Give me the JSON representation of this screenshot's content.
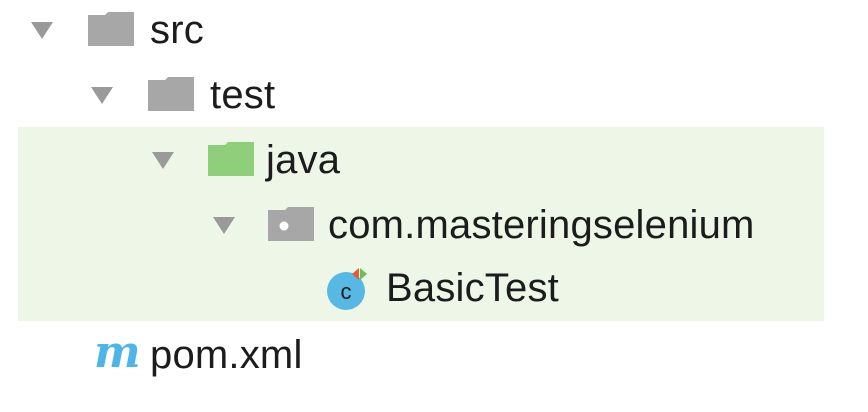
{
  "tree": {
    "nodes": [
      {
        "label": "src",
        "icon": "folder-icon",
        "expanded": true,
        "depth": 0
      },
      {
        "label": "test",
        "icon": "folder-icon",
        "expanded": true,
        "depth": 1
      },
      {
        "label": "java",
        "icon": "test-source-folder-icon",
        "expanded": true,
        "depth": 2,
        "highlighted": true
      },
      {
        "label": "com.masteringselenium",
        "icon": "package-icon",
        "expanded": true,
        "depth": 3,
        "highlighted": true
      },
      {
        "label": "BasicTest",
        "icon": "java-class-icon",
        "depth": 4,
        "highlighted": true
      },
      {
        "label": "pom.xml",
        "icon": "maven-icon",
        "depth": 0
      }
    ],
    "maven_icon_glyph": "m",
    "class_icon_glyph": "c"
  },
  "colors": {
    "highlight": "#eef6e8",
    "folder_gray": "#a7a7a7",
    "test_folder_green": "#8fcf7b",
    "class_circle": "#57b8e3",
    "maven_blue": "#4fb4e6",
    "arrow_gray": "#9a9a9a"
  }
}
